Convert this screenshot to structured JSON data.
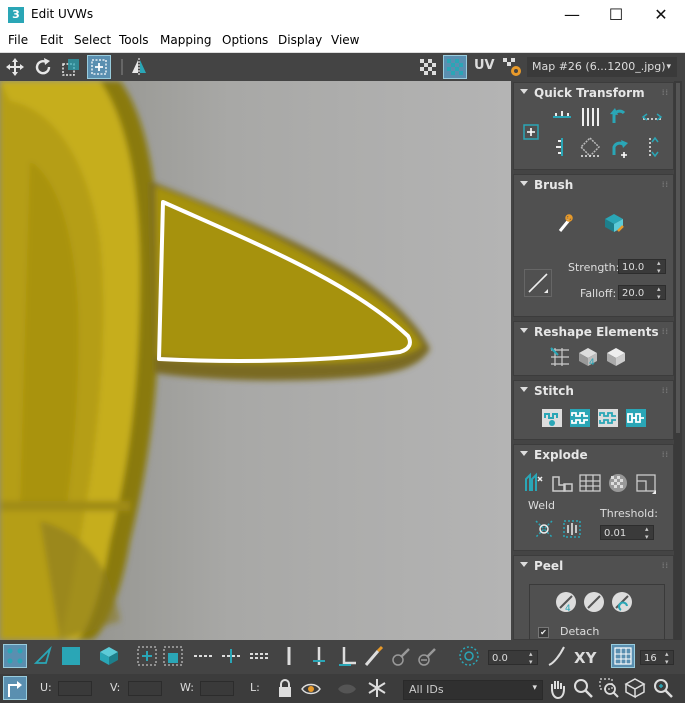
{
  "window": {
    "title": "Edit UVWs",
    "app_icon_glyph": "3",
    "minimize": "—",
    "maximize": "☐",
    "close": "✕"
  },
  "menu": [
    "File",
    "Edit",
    "Select",
    "Tools",
    "Mapping",
    "Options",
    "Display",
    "View"
  ],
  "toolbar": {
    "uv_label": "UV",
    "map_dropdown": "Map #26 (6...1200_.jpg)"
  },
  "panel": {
    "quick_transform": {
      "title": "Quick Transform"
    },
    "brush": {
      "title": "Brush",
      "strength_label": "Strength:",
      "strength_value": "10.0",
      "falloff_label": "Falloff:",
      "falloff_value": "20.0"
    },
    "reshape": {
      "title": "Reshape Elements"
    },
    "stitch": {
      "title": "Stitch"
    },
    "explode": {
      "title": "Explode",
      "weld_label": "Weld",
      "threshold_label": "Threshold:",
      "threshold_value": "0.01"
    },
    "peel": {
      "title": "Peel",
      "detach_label": "Detach",
      "detach_checked": true
    }
  },
  "bottom": {
    "rotate_value": "0.0",
    "xy_label": "XY",
    "grid_value": "16",
    "u_label": "U:",
    "v_label": "V:",
    "w_label": "W:",
    "l_label": "L:",
    "ids_dropdown": "All IDs"
  },
  "colors": {
    "accent": "#2aa6b6",
    "panel_bg": "#444444",
    "rollout_bg": "#505050",
    "uv_texture_yellow": "#b5a200",
    "uv_outline": "#ffffff"
  }
}
